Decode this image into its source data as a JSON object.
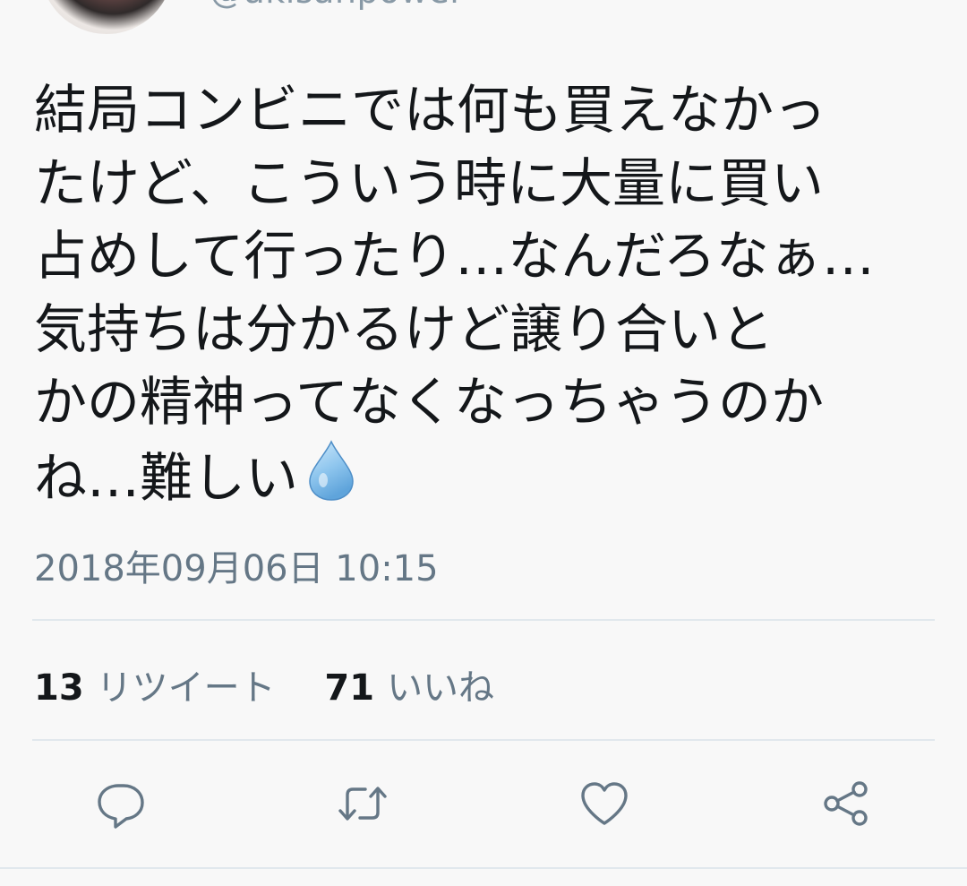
{
  "author": {
    "handle": "@akisanpower"
  },
  "tweet": {
    "lines": [
      "結局コンビニでは何も買えなかっ",
      "たけど、こういう時に大量に買い",
      "占めして行ったり…なんだろなぁ…",
      "気持ちは分かるけど譲り合いと",
      "かの精神ってなくなっちゃうのか",
      "ね…難しい"
    ],
    "emoji": "droplet-emoji",
    "timestamp": "2018年09月06日 10:15"
  },
  "stats": {
    "retweets_count": "13",
    "retweets_label": "リツイート",
    "likes_count": "71",
    "likes_label": "いいね"
  },
  "actions": [
    {
      "icon": "reply-icon"
    },
    {
      "icon": "retweet-icon"
    },
    {
      "icon": "like-icon"
    },
    {
      "icon": "share-icon"
    }
  ],
  "colors": {
    "text": "#14171a",
    "secondary": "#657786",
    "divider": "#e1e8ed",
    "background": "#f8f8f8"
  }
}
